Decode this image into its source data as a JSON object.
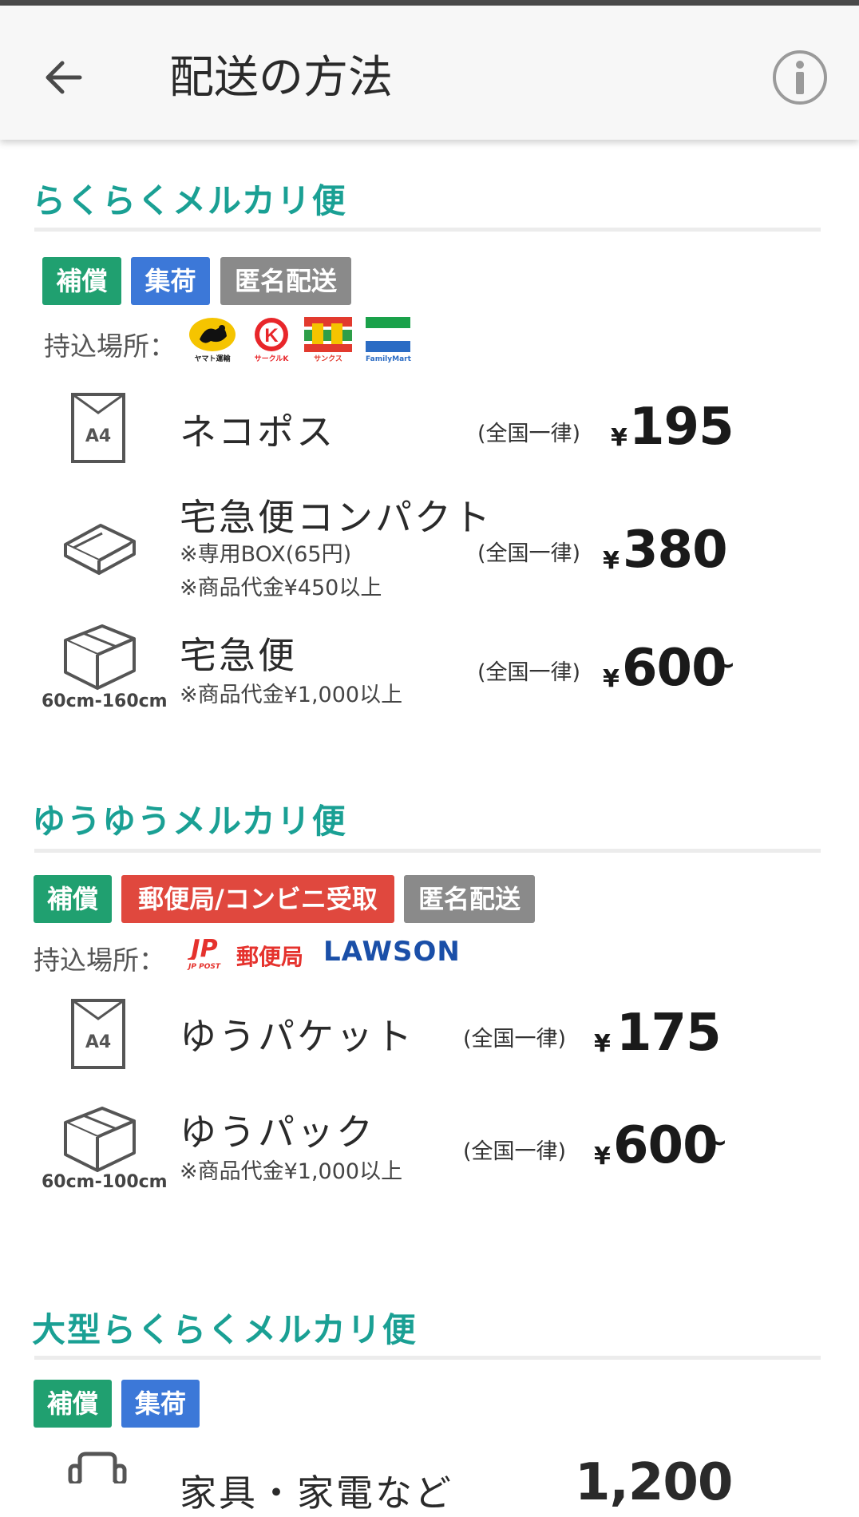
{
  "header": {
    "title": "配送の方法"
  },
  "rakuraku": {
    "title": "らくらくメルカリ便",
    "tags": [
      "補償",
      "集荷",
      "匿名配送"
    ],
    "dropoff_label": "持込場所：",
    "logos": [
      "ヤマト運輸",
      "サークルK",
      "サンクス",
      "FamilyMart"
    ],
    "items": [
      {
        "name": "ネコポス",
        "note1": "",
        "note2": "",
        "uniform": "(全国一律)",
        "yen": "¥",
        "price": "195",
        "tilde": "",
        "icon": "a4-envelope-icon",
        "size": ""
      },
      {
        "name": "宅急便コンパクト",
        "note1": "※専用BOX(65円)",
        "note2": "※商品代金¥450以上",
        "uniform": "(全国一律)",
        "yen": "¥",
        "price": "380",
        "tilde": "",
        "icon": "flat-box-icon",
        "size": ""
      },
      {
        "name": "宅急便",
        "note1": "※商品代金¥1,000以上",
        "note2": "",
        "uniform": "(全国一律)",
        "yen": "¥",
        "price": "600",
        "tilde": "~",
        "icon": "box-icon",
        "size": "60cm-160cm"
      }
    ]
  },
  "yuyu": {
    "title": "ゆうゆうメルカリ便",
    "tags": [
      "補償",
      "郵便局/コンビニ受取",
      "匿名配送"
    ],
    "dropoff_label": "持込場所：",
    "logos": [
      "JP POST",
      "郵便局",
      "LAWSON"
    ],
    "items": [
      {
        "name": "ゆうパケット",
        "note1": "",
        "uniform": "(全国一律)",
        "yen": "¥",
        "price": "175",
        "tilde": "",
        "icon": "a4-envelope-icon",
        "size": ""
      },
      {
        "name": "ゆうパック",
        "note1": "※商品代金¥1,000以上",
        "uniform": "(全国一律)",
        "yen": "¥",
        "price": "600",
        "tilde": "~",
        "icon": "box-icon",
        "size": "60cm-100cm"
      }
    ]
  },
  "large": {
    "title": "大型らくらくメルカリ便",
    "tags": [
      "補償",
      "集荷"
    ],
    "partial_name": "家具・家電など",
    "partial_price": "1,200"
  },
  "colors": {
    "accent": "#1aa094",
    "green_tag": "#20a070",
    "blue_tag": "#3c78d8",
    "gray_tag": "#8a8a8a",
    "red_tag": "#e0483e"
  }
}
